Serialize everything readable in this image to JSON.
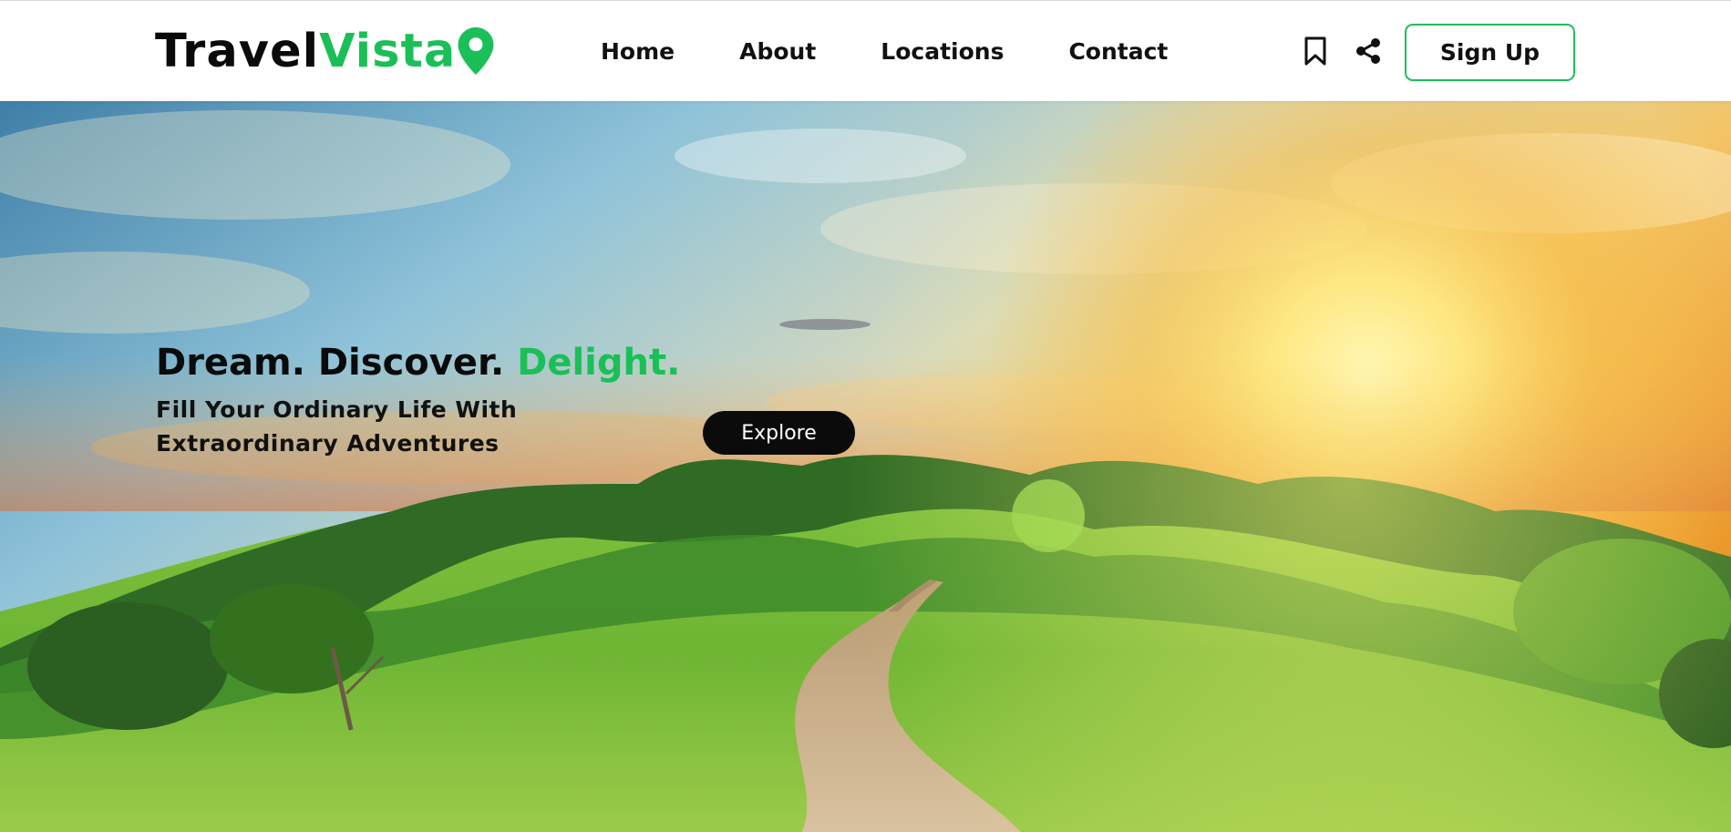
{
  "header": {
    "logo": {
      "part1": "Travel",
      "part2": "Vista",
      "icon": "map-pin-icon"
    },
    "nav": [
      {
        "label": "Home"
      },
      {
        "label": "About"
      },
      {
        "label": "Locations"
      },
      {
        "label": "Contact"
      }
    ],
    "icons": [
      "bookmark-icon",
      "share-icon"
    ],
    "signup_label": "Sign Up"
  },
  "hero": {
    "headline_part1": "Dream. Discover. ",
    "headline_accent": "Delight.",
    "subline": "Fill Your Ordinary Life With Extraordinary Adventures",
    "cta_label": "Explore",
    "background": "sunset-landscape-with-trees-and-dirt-path"
  },
  "colors": {
    "accent": "#1bbf58",
    "text": "#0a0a0a",
    "cta_bg": "#0b0b0b"
  }
}
